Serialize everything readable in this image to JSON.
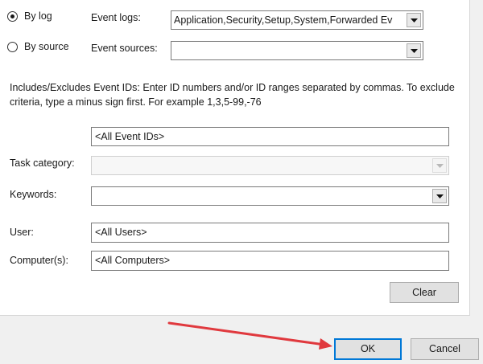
{
  "filter": {
    "by_log_label": "By log",
    "by_source_label": "By source",
    "event_logs_label": "Event logs:",
    "event_logs_value": "Application,Security,Setup,System,Forwarded Ev",
    "event_sources_label": "Event sources:",
    "event_sources_value": "",
    "description": "Includes/Excludes Event IDs: Enter ID numbers and/or ID ranges separated by commas. To exclude criteria, type a minus sign first. For example 1,3,5-99,-76",
    "event_ids_value": "<All Event IDs>",
    "task_category_label": "Task category:",
    "task_category_value": "",
    "keywords_label": "Keywords:",
    "keywords_value": "",
    "user_label": "User:",
    "user_value": "<All Users>",
    "computer_label": "Computer(s):",
    "computer_value": "<All Computers>",
    "clear_label": "Clear",
    "selected_mode": "By log"
  },
  "footer": {
    "ok_label": "OK",
    "cancel_label": "Cancel"
  },
  "colors": {
    "annotation_arrow": "#e0393e",
    "default_button_border": "#0078d7"
  },
  "icons": {
    "dropdown": "chevron-down-icon",
    "annotation": "red-arrow-icon"
  }
}
